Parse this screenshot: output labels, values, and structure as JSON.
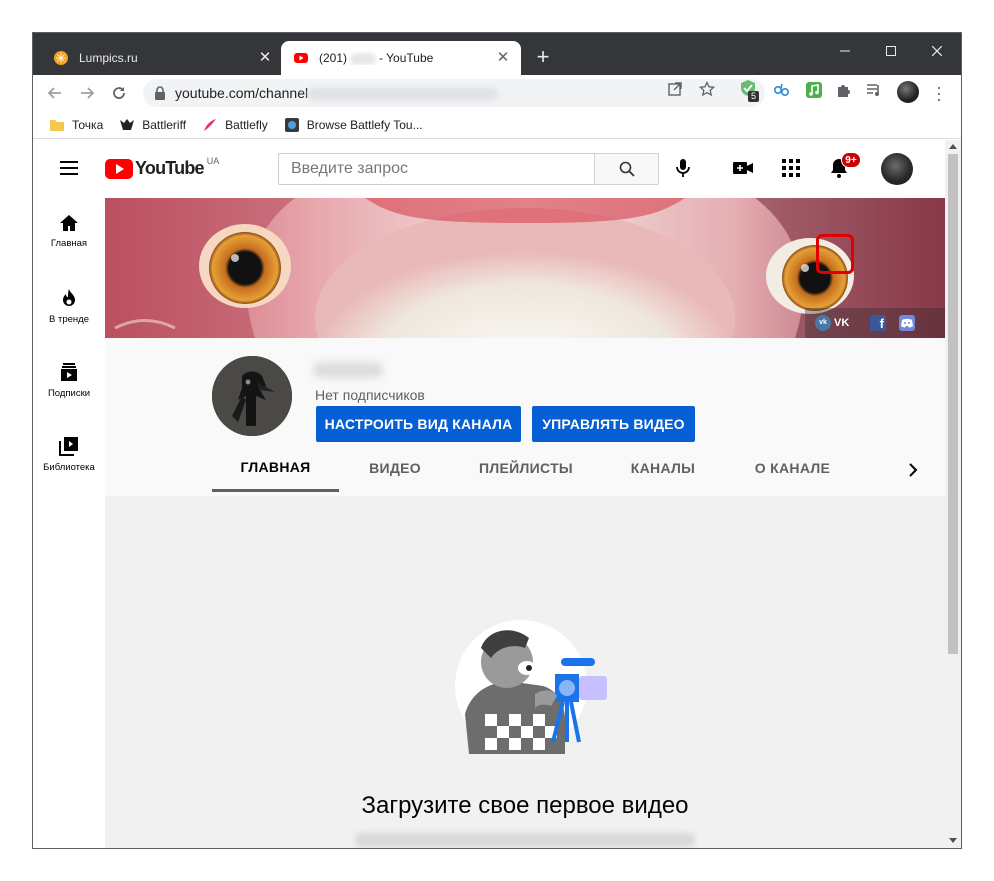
{
  "browser": {
    "tabs": [
      {
        "title": "Lumpics.ru",
        "active": false
      },
      {
        "title_prefix": "(201)",
        "title_suffix": "- YouTube",
        "active": true
      }
    ],
    "close_symbol": "✕",
    "new_tab_symbol": "+",
    "url_prefix": "youtube.com/channel",
    "extension_badge": "5",
    "bookmarks": [
      {
        "label": "Точка",
        "icon": "folder-icon"
      },
      {
        "label": "Battleriff",
        "icon": "battleriff-icon"
      },
      {
        "label": "Battlefly",
        "icon": "battlefly-icon"
      },
      {
        "label": "Browse Battlefy Tou...",
        "icon": "battlefy-icon"
      }
    ]
  },
  "youtube": {
    "logo_text": "YouTube",
    "region": "UA",
    "search_placeholder": "Введите запрос",
    "notification_count": "9+",
    "sidebar": [
      {
        "label": "Главная",
        "icon": "home-icon"
      },
      {
        "label": "В тренде",
        "icon": "trending-icon"
      },
      {
        "label": "Подписки",
        "icon": "subscriptions-icon"
      },
      {
        "label": "Библиотека",
        "icon": "library-icon"
      }
    ],
    "banner_links": {
      "vk": "VK",
      "vk_icon": "vk",
      "facebook": "f"
    },
    "channel": {
      "subscribers": "Нет подписчиков",
      "customize_button": "НАСТРОИТЬ ВИД КАНАЛА",
      "manage_button": "УПРАВЛЯТЬ ВИДЕО",
      "tabs": [
        "ГЛАВНАЯ",
        "ВИДЕО",
        "ПЛЕЙЛИСТЫ",
        "КАНАЛЫ",
        "О КАНАЛЕ"
      ],
      "active_tab": "ГЛАВНАЯ"
    },
    "empty_state": {
      "title": "Загрузите свое первое видео"
    }
  },
  "colors": {
    "youtube_red": "#ff0000",
    "button_blue": "#065fd4",
    "highlight_red": "#e00000",
    "chrome_dark": "#35363a"
  }
}
